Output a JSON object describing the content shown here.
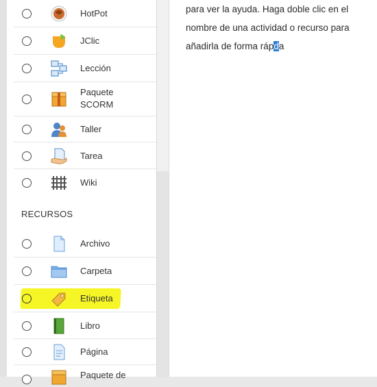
{
  "activities": [
    {
      "label": "HotPot",
      "icon": "hotpot-icon"
    },
    {
      "label": "JClic",
      "icon": "jclic-icon"
    },
    {
      "label": "Lección",
      "icon": "lesson-icon"
    },
    {
      "label": "Paquete SCORM",
      "label_line1": "Paquete",
      "label_line2": "SCORM",
      "icon": "scorm-package-icon"
    },
    {
      "label": "Taller",
      "icon": "workshop-icon"
    },
    {
      "label": "Tarea",
      "icon": "assignment-icon"
    },
    {
      "label": "Wiki",
      "icon": "wiki-icon"
    }
  ],
  "resources_heading": "RECURSOS",
  "resources": [
    {
      "label": "Archivo",
      "icon": "file-icon"
    },
    {
      "label": "Carpeta",
      "icon": "folder-icon"
    },
    {
      "label": "Etiqueta",
      "icon": "label-tag-icon",
      "highlighted": true
    },
    {
      "label": "Libro",
      "icon": "book-icon"
    },
    {
      "label": "Página",
      "icon": "page-icon"
    },
    {
      "label": "Paquete de",
      "icon": "content-package-icon"
    }
  ],
  "help": {
    "line1": "para ver la ayuda. Haga doble clic en el",
    "line2": "nombre de una actividad o recurso para",
    "line3_pre": "añadirla de forma ráp",
    "line3_sel": "d",
    "line3_post": "a"
  },
  "colors": {
    "highlight": "#f5f500",
    "selection": "#2a7ed6"
  }
}
